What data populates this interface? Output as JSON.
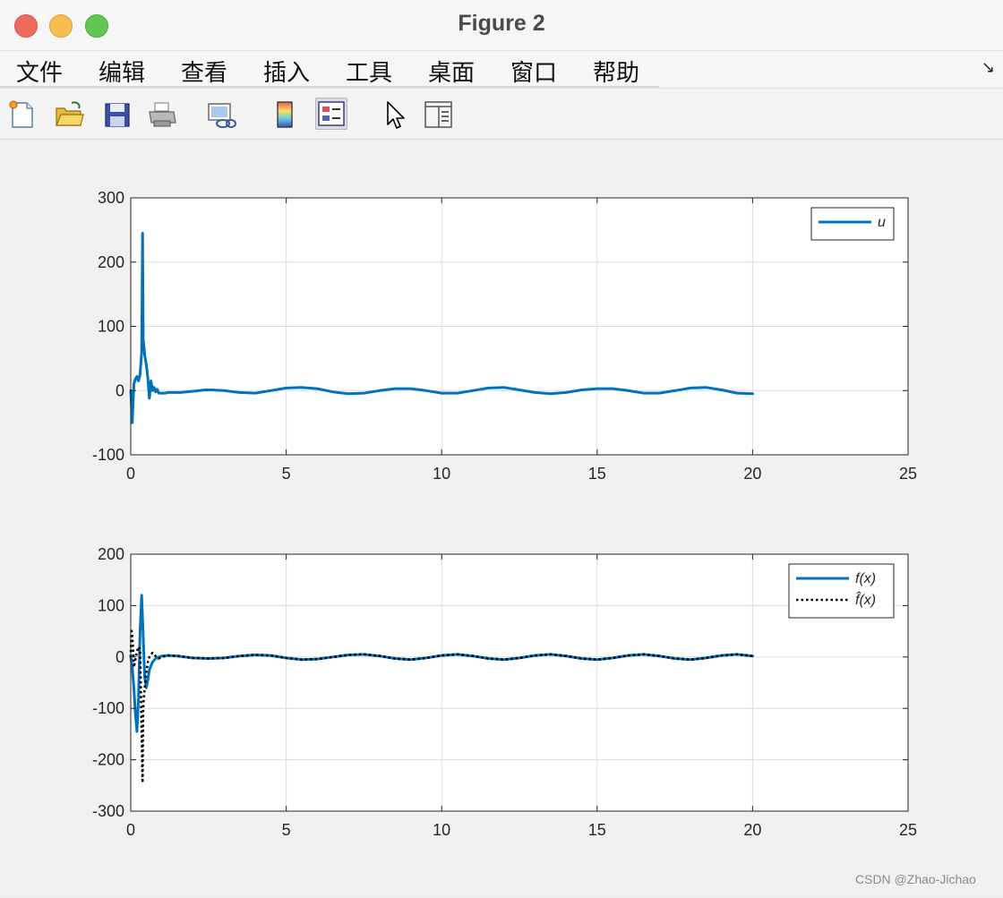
{
  "window": {
    "title": "Figure 2"
  },
  "menu": {
    "items": [
      "文件",
      "编辑",
      "查看",
      "插入",
      "工具",
      "桌面",
      "窗口",
      "帮助"
    ],
    "overflow_icon": "dock-arrow-icon"
  },
  "toolbar": {
    "buttons": [
      {
        "name": "new-figure-icon"
      },
      {
        "name": "open-file-icon"
      },
      {
        "name": "save-icon"
      },
      {
        "name": "print-icon"
      },
      {
        "name": "link-plot-icon"
      },
      {
        "name": "colorbar-icon"
      },
      {
        "name": "legend-icon"
      },
      {
        "name": "pointer-icon"
      },
      {
        "name": "property-editor-icon"
      }
    ]
  },
  "chart_data": [
    {
      "type": "line",
      "title": "",
      "xlabel": "",
      "ylabel": "",
      "xlim": [
        0,
        25
      ],
      "ylim": [
        -100,
        300
      ],
      "xticks": [
        0,
        5,
        10,
        15,
        20,
        25
      ],
      "yticks": [
        -100,
        0,
        100,
        200,
        300
      ],
      "xtick_labels": [
        "0",
        "5",
        "10",
        "15",
        "20",
        "25"
      ],
      "ytick_labels": [
        "-100",
        "0",
        "100",
        "200",
        "300"
      ],
      "grid": true,
      "legend_position": "top-right",
      "series": [
        {
          "name": "u",
          "style": "solid",
          "color": "#0072bd",
          "x": [
            0,
            0.05,
            0.1,
            0.15,
            0.2,
            0.25,
            0.3,
            0.35,
            0.38,
            0.4,
            0.42,
            0.45,
            0.5,
            0.55,
            0.6,
            0.65,
            0.7,
            0.75,
            0.8,
            0.85,
            0.9,
            1.0,
            1.1,
            1.2,
            1.4,
            1.6,
            2.0,
            2.4,
            2.6,
            3.0,
            3.5,
            4.0,
            4.5,
            5.0,
            5.5,
            6.0,
            6.5,
            7.0,
            7.5,
            8.0,
            8.5,
            9.0,
            9.5,
            10.0,
            10.5,
            11.0,
            11.5,
            12.0,
            12.5,
            13.0,
            13.5,
            14.0,
            14.5,
            15.0,
            15.5,
            16.0,
            16.5,
            17.0,
            17.5,
            18.0,
            18.5,
            19.0,
            19.5,
            20.0
          ],
          "y": [
            0,
            -50,
            10,
            18,
            22,
            15,
            25,
            60,
            245,
            80,
            70,
            55,
            40,
            20,
            -12,
            15,
            0,
            5,
            -2,
            2,
            -4,
            -4,
            -4,
            -3,
            -3,
            -3,
            -1,
            1,
            1,
            0,
            -3,
            -4,
            0,
            4,
            5,
            3,
            -2,
            -5,
            -4,
            0,
            3,
            3,
            0,
            -4,
            -4,
            0,
            4,
            5,
            1,
            -3,
            -5,
            -3,
            1,
            3,
            3,
            0,
            -4,
            -4,
            0,
            4,
            5,
            1,
            -4,
            -5
          ]
        }
      ]
    },
    {
      "type": "line",
      "title": "",
      "xlabel": "",
      "ylabel": "",
      "xlim": [
        0,
        25
      ],
      "ylim": [
        -300,
        200
      ],
      "xticks": [
        0,
        5,
        10,
        15,
        20,
        25
      ],
      "yticks": [
        -300,
        -200,
        -100,
        0,
        100,
        200
      ],
      "xtick_labels": [
        "0",
        "5",
        "10",
        "15",
        "20",
        "25"
      ],
      "ytick_labels": [
        "-300",
        "-200",
        "-100",
        "0",
        "100",
        "200"
      ],
      "grid": true,
      "legend_position": "top-right",
      "series": [
        {
          "name": "f(x)",
          "style": "solid",
          "color": "#0072bd",
          "x": [
            0,
            0.05,
            0.1,
            0.15,
            0.2,
            0.25,
            0.3,
            0.35,
            0.4,
            0.45,
            0.5,
            0.55,
            0.6,
            0.7,
            0.8,
            1.0,
            1.2,
            1.5,
            2.0,
            2.5,
            3.0,
            3.5,
            4.0,
            4.5,
            5.0,
            5.5,
            6.0,
            6.5,
            7.0,
            7.5,
            8.0,
            8.5,
            9.0,
            9.5,
            10.0,
            10.5,
            11.0,
            11.5,
            12.0,
            12.5,
            13.0,
            13.5,
            14.0,
            14.5,
            15.0,
            15.5,
            16.0,
            16.5,
            17.0,
            17.5,
            18.0,
            18.5,
            19.0,
            19.5,
            20.0
          ],
          "y": [
            0,
            -20,
            -60,
            -110,
            -145,
            -80,
            50,
            120,
            40,
            -40,
            -60,
            -45,
            -25,
            -10,
            -3,
            2,
            3,
            2,
            -2,
            -3,
            -2,
            2,
            4,
            3,
            -2,
            -5,
            -4,
            0,
            4,
            5,
            2,
            -3,
            -5,
            -2,
            3,
            5,
            2,
            -3,
            -5,
            -2,
            3,
            5,
            2,
            -3,
            -5,
            -2,
            3,
            5,
            2,
            -3,
            -5,
            -2,
            3,
            5,
            2
          ]
        },
        {
          "name": "f̂(x)",
          "style": "dotted",
          "color": "#000000",
          "x": [
            0,
            0.02,
            0.05,
            0.08,
            0.1,
            0.15,
            0.2,
            0.25,
            0.3,
            0.35,
            0.38,
            0.4,
            0.42,
            0.45,
            0.5,
            0.55,
            0.6,
            0.65,
            0.7,
            0.8,
            0.9,
            1.0,
            1.2,
            1.5,
            2.0,
            2.5,
            3.0,
            3.5,
            4.0,
            4.5,
            5.0,
            5.5,
            6.0,
            6.5,
            7.0,
            7.5,
            8.0,
            8.5,
            9.0,
            9.5,
            10.0,
            10.5,
            11.0,
            11.5,
            12.0,
            12.5,
            13.0,
            13.5,
            14.0,
            14.5,
            15.0,
            15.5,
            16.0,
            16.5,
            17.0,
            17.5,
            18.0,
            18.5,
            19.0,
            19.5,
            20.0
          ],
          "y": [
            0,
            55,
            40,
            10,
            -20,
            -5,
            10,
            20,
            15,
            -150,
            -245,
            -100,
            -80,
            -60,
            -30,
            -10,
            0,
            5,
            8,
            2,
            -3,
            0,
            3,
            2,
            -2,
            -3,
            -2,
            2,
            4,
            3,
            -2,
            -5,
            -4,
            0,
            4,
            5,
            2,
            -3,
            -5,
            -2,
            3,
            5,
            2,
            -3,
            -5,
            -2,
            3,
            5,
            2,
            -3,
            -5,
            -2,
            3,
            5,
            2,
            -3,
            -5,
            -2,
            3,
            5,
            2
          ]
        }
      ]
    }
  ],
  "watermark": "CSDN @Zhao-Jichao"
}
